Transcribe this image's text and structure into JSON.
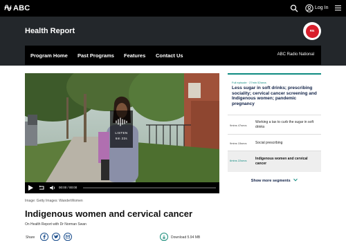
{
  "topbar": {
    "logo_text": "ABC",
    "login_label": "Log In",
    "icons": [
      "abc-wave-icon",
      "search-icon",
      "user-icon",
      "menu-icon"
    ]
  },
  "program": {
    "title": "Health Report",
    "badge_text": "RN"
  },
  "nav": {
    "items": [
      "Program Home",
      "Past Programs",
      "Features",
      "Contact Us"
    ],
    "right_label": "ABC Radio National"
  },
  "player": {
    "listen_label": "LISTEN",
    "duration_label": "6m 22s",
    "time_label": "00:00 / 00:00"
  },
  "article": {
    "caption": "Image: Getty Images: WanderWomen",
    "title": "Indigenous women and cervical cancer",
    "byline": "On Health Report with Dr Norman Swan",
    "share_label": "Share",
    "download_label": "Download 5.94 MB"
  },
  "sidebar": {
    "meta": "Full episode · 27min 52secs",
    "headline": "Less sugar in soft drinks; prescribing sociality; cervical cancer screening and Indigenous women; pandemic pregnancy",
    "segments": [
      {
        "duration": "9mins 47secs",
        "title": "Working a tax to curb the sugar in soft drinks",
        "active": false
      },
      {
        "duration": "9mins 15secs",
        "title": "Social prescribing",
        "active": false
      },
      {
        "duration": "6mins 22secs",
        "title": "Indigenous women and cervical cancer",
        "active": true
      }
    ],
    "more_label": "Show more segments"
  },
  "colors": {
    "accent": "#0e8b80",
    "header_bg": "#23272b",
    "nav_bg": "#000000",
    "badge_red": "#d81e2c"
  }
}
